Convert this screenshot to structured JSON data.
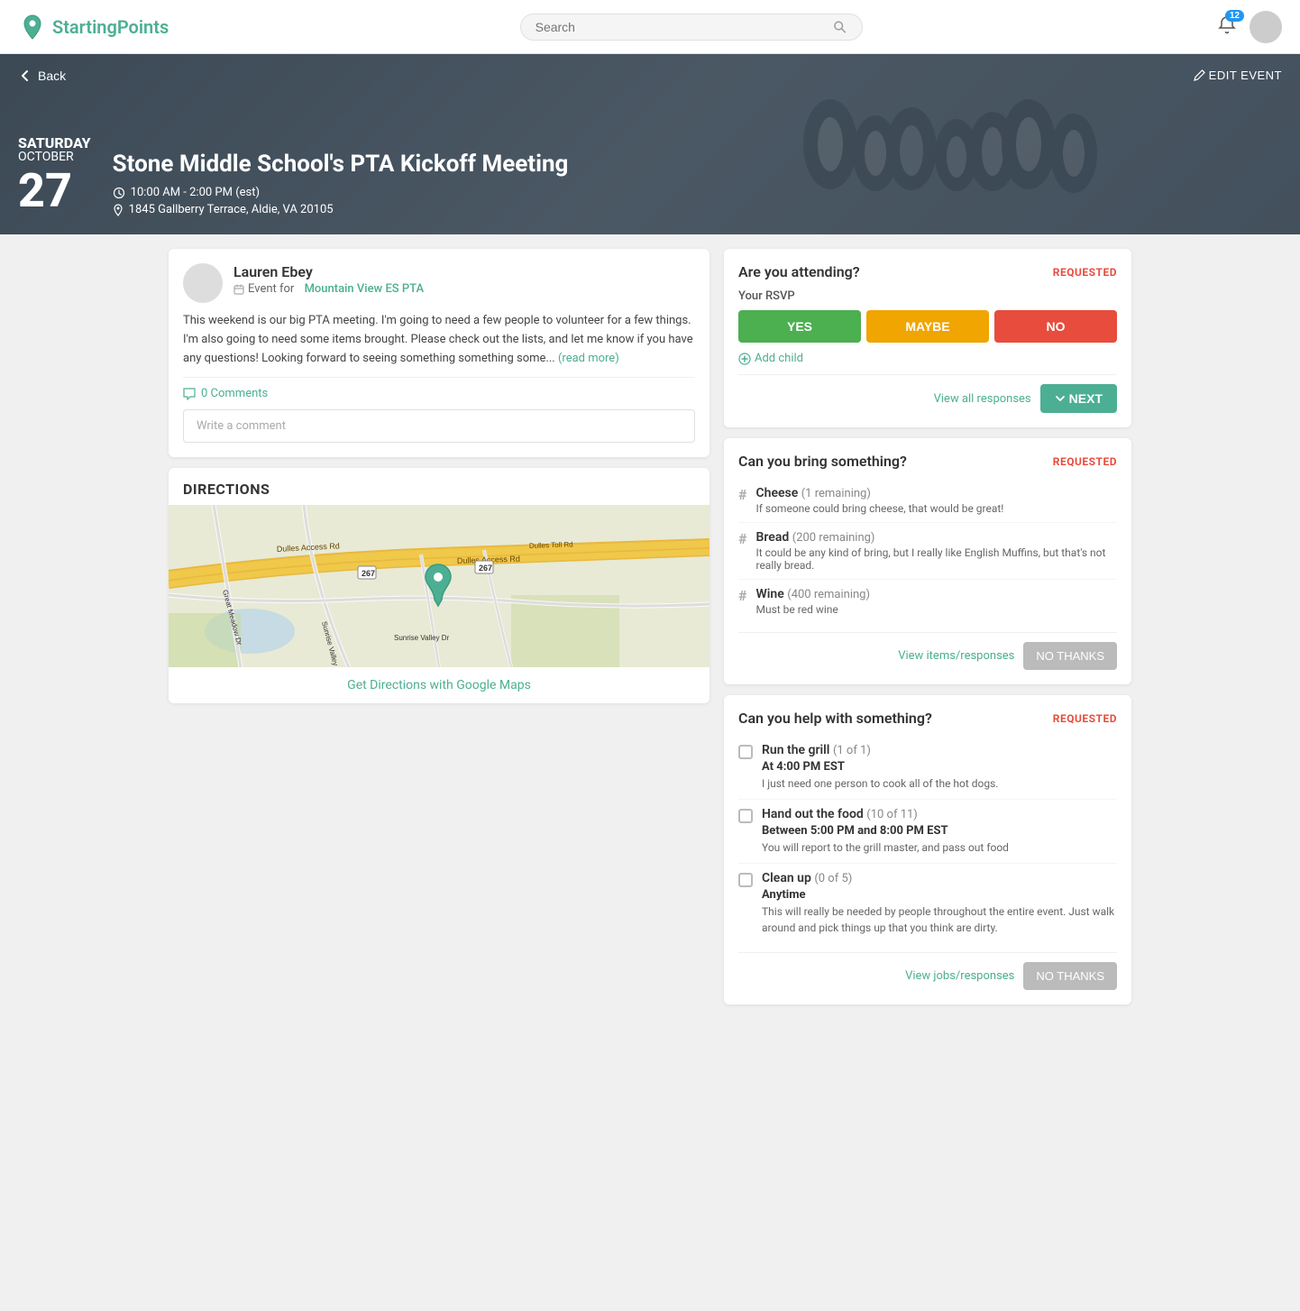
{
  "header": {
    "logo_text_start": "Starting",
    "logo_text_end": "Points",
    "search_placeholder": "Search",
    "bell_badge": "12",
    "back_label": "Back",
    "edit_label": "EDIT EVENT"
  },
  "event": {
    "day_name": "SATURDAY",
    "month": "OCTOBER",
    "day_num": "27",
    "title": "Stone Middle School's PTA Kickoff Meeting",
    "time": "10:00 AM - 2:00 PM (est)",
    "address": "1845 Gallberry Terrace, Aldie, VA 20105"
  },
  "post": {
    "author": "Lauren Ebey",
    "org_prefix": "Event for",
    "org_name": "Mountain View ES PTA",
    "body": "This weekend is our big PTA meeting. I'm going to need a few people to volunteer for a few things. I'm also going to need some items brought. Please check out the lists, and let me know if you have any questions! Looking forward to seeing something something some...",
    "read_more": "(read more)",
    "comments_count": "0 Comments",
    "comment_placeholder": "Write a comment"
  },
  "directions": {
    "heading": "DIRECTIONS",
    "link_label": "Get Directions with Google Maps"
  },
  "rsvp": {
    "title": "Are you attending?",
    "status": "REQUESTED",
    "rsvp_label": "Your RSVP",
    "yes_label": "YES",
    "maybe_label": "MAYBE",
    "no_label": "NO",
    "add_child_label": "Add child",
    "view_all_label": "View all responses",
    "next_label": "NEXT"
  },
  "bring": {
    "title": "Can you bring something?",
    "status": "REQUESTED",
    "items": [
      {
        "name": "Cheese",
        "count": "(1 remaining)",
        "desc": "If someone could bring cheese, that would be great!"
      },
      {
        "name": "Bread",
        "count": "(200 remaining)",
        "desc": "It could be any kind of bring, but I really like English Muffins, but that's not really bread."
      },
      {
        "name": "Wine",
        "count": "(400 remaining)",
        "desc": "Must be red wine"
      }
    ],
    "view_label": "View items/responses",
    "no_thanks_label": "NO THANKS"
  },
  "help": {
    "title": "Can you help with something?",
    "status": "REQUESTED",
    "items": [
      {
        "name": "Run the grill",
        "count": "(1 of 1)",
        "time": "At 4:00 PM EST",
        "desc": "I just need one person to cook all of the hot dogs."
      },
      {
        "name": "Hand out the food",
        "count": "(10 of 11)",
        "time": "Between 5:00 PM and 8:00 PM EST",
        "desc": "You will report to the grill master, and pass out food"
      },
      {
        "name": "Clean up",
        "count": "(0 of 5)",
        "time": "Anytime",
        "desc": "This will really be needed by people throughout the entire event. Just walk around and pick things up that you think are dirty."
      }
    ],
    "view_label": "View jobs/responses",
    "no_thanks_label": "NO THANKS"
  }
}
